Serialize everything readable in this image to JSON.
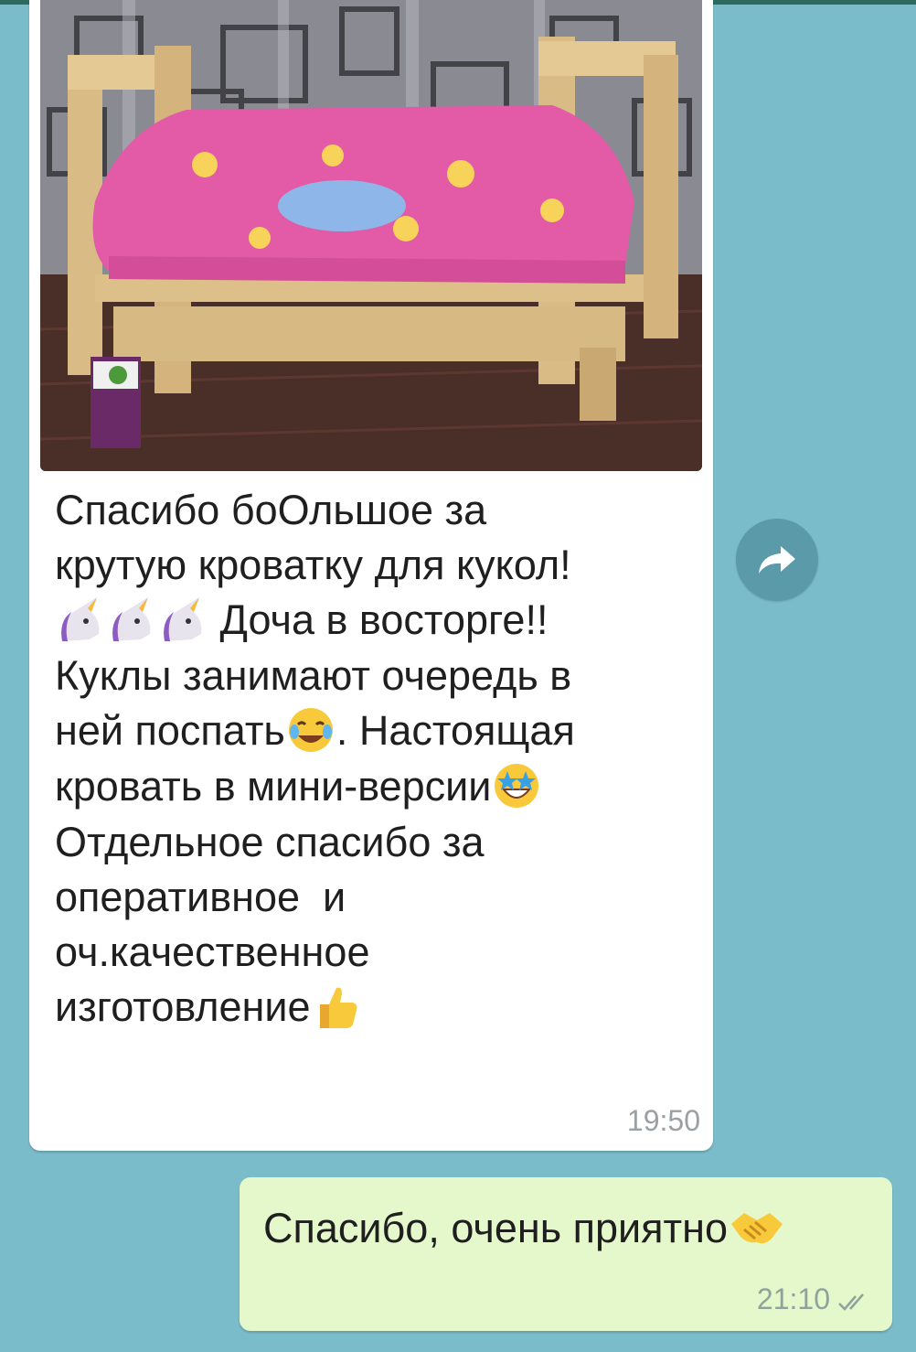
{
  "colors": {
    "chat_background": "#7bbccb",
    "incoming_bubble": "#ffffff",
    "outgoing_bubble": "#e5f8cc",
    "forward_button": "#5a9aa9",
    "read_ticks": "#90a39a"
  },
  "incoming": {
    "photo_icon": "photo-of-wooden-doll-bed",
    "lines": {
      "l1": "Спасибо боОльшое за",
      "l2": "крутую кроватку для кукол!",
      "l3": "Доча в восторге!!",
      "l4": "Куклы занимают очередь в",
      "l5a": "ней поспать",
      "l5b": ". Настоящая",
      "l6": "кровать в мини-версии",
      "l7": "Отдельное спасибо за",
      "l8": "оперативное  и",
      "l9": "оч.качественное",
      "l10": "изготовление"
    },
    "time": "19:50"
  },
  "forward": {
    "icon": "forward-arrow-icon"
  },
  "outgoing": {
    "text": "Спасибо, очень приятно",
    "time": "21:10",
    "status_icon": "double-check-icon"
  }
}
